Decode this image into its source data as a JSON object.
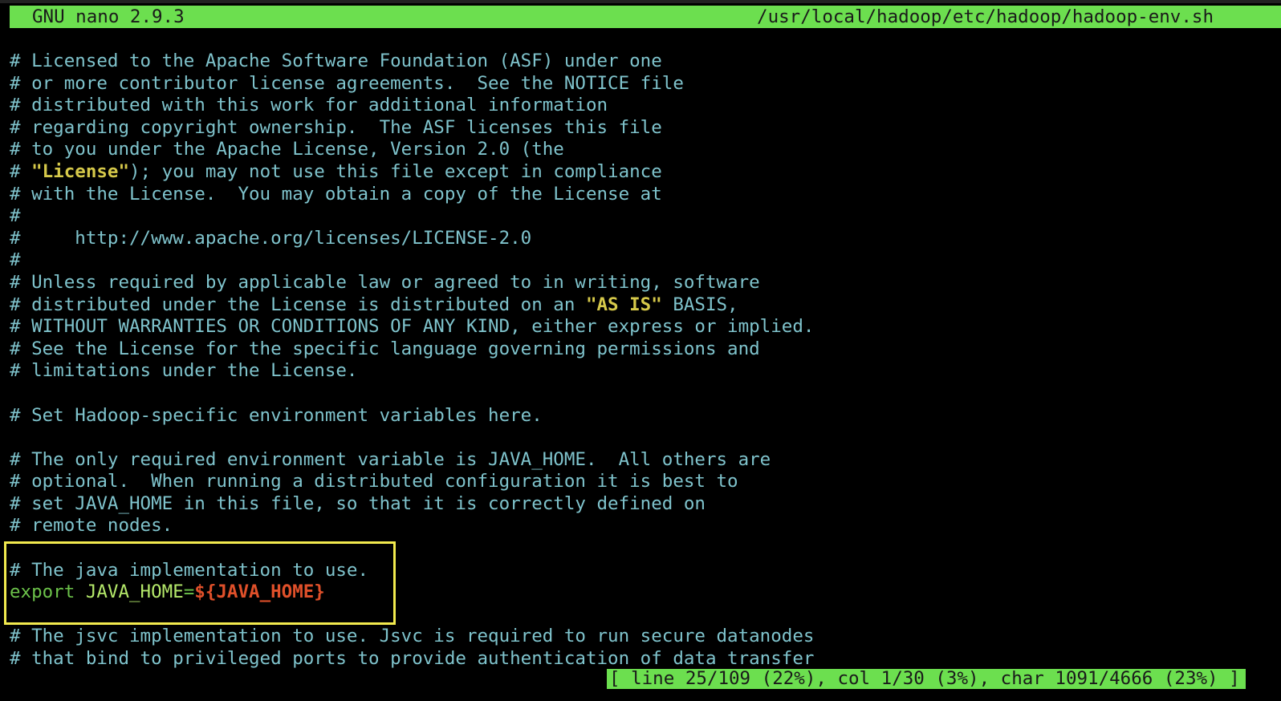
{
  "titlebar": {
    "app": "GNU nano 2.9.3",
    "path": "/usr/local/hadoop/etc/hadoop/hadoop-env.sh"
  },
  "colors": {
    "bar_bg": "#6cdf4f",
    "comment": "#7fc3cc",
    "string_highlight": "#d6c94a",
    "keyword": "#6cc24a",
    "variable": "#b4e86a",
    "expansion": "#e0502a",
    "annotation_box": "#f2ea4e"
  },
  "lines": {
    "l1": "# Licensed to the Apache Software Foundation (ASF) under one",
    "l2": "# or more contributor license agreements.  See the NOTICE file",
    "l3": "# distributed with this work for additional information",
    "l4": "# regarding copyright ownership.  The ASF licenses this file",
    "l5": "# to you under the Apache License, Version 2.0 (the",
    "l6_pre": "# ",
    "l6_str": "\"License\"",
    "l6_post": "); you may not use this file except in compliance",
    "l7": "# with the License.  You may obtain a copy of the License at",
    "l8": "#",
    "l9": "#     http://www.apache.org/licenses/LICENSE-2.0",
    "l10": "#",
    "l11": "# Unless required by applicable law or agreed to in writing, software",
    "l12_pre": "# distributed under the License is distributed on an ",
    "l12_str": "\"AS IS\"",
    "l12_post": " BASIS,",
    "l13": "# WITHOUT WARRANTIES OR CONDITIONS OF ANY KIND, either express or implied.",
    "l14": "# See the License for the specific language governing permissions and",
    "l15": "# limitations under the License.",
    "l16": "",
    "l17": "# Set Hadoop-specific environment variables here.",
    "l18": "",
    "l19": "# The only required environment variable is JAVA_HOME.  All others are",
    "l20": "# optional.  When running a distributed configuration it is best to",
    "l21": "# set JAVA_HOME in this file, so that it is correctly defined on",
    "l22": "# remote nodes.",
    "l23": "",
    "l24": "# The java implementation to use.",
    "l25_kw": "export",
    "l25_var": "JAVA_HOME",
    "l25_op": "=",
    "l25_exp": "${JAVA_HOME}",
    "l26": "",
    "l27": "# The jsvc implementation to use. Jsvc is required to run secure datanodes",
    "l28": "# that bind to privileged ports to provide authentication of data transfer"
  },
  "status": {
    "text": "[ line 25/109 (22%), col 1/30 (3%), char 1091/4666 (23%) ]"
  }
}
